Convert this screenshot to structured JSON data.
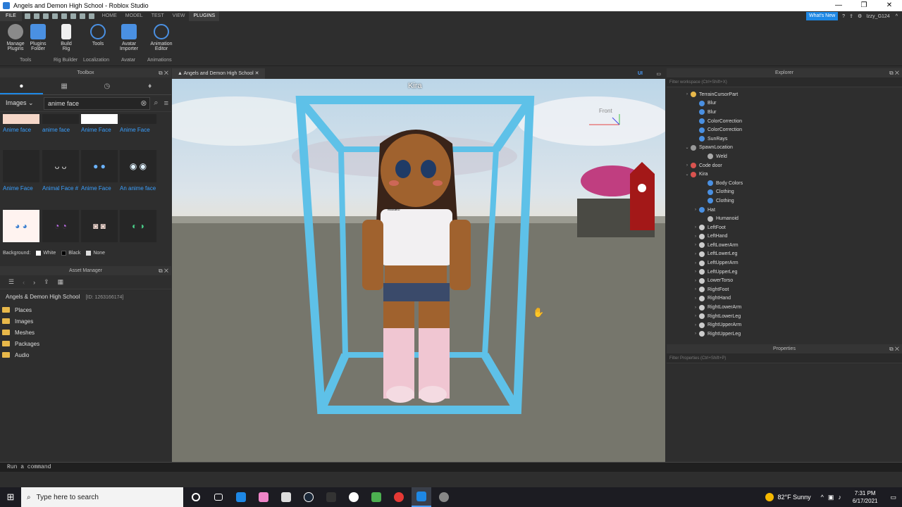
{
  "window": {
    "title": "Angels and Demon High School - Roblox Studio",
    "min": "—",
    "max": "❐",
    "close": "✕"
  },
  "menu": {
    "file": "FILE",
    "tabs": [
      "HOME",
      "MODEL",
      "TEST",
      "VIEW",
      "PLUGINS"
    ],
    "whats_new": "What's New",
    "user": "Izzy_G124"
  },
  "ribbon": {
    "buttons": [
      {
        "l1": "Manage",
        "l2": "Plugins"
      },
      {
        "l1": "Plugins",
        "l2": "Folder"
      },
      {
        "l1": "Build",
        "l2": "Rig"
      },
      {
        "l1": "Tools",
        "l2": ""
      },
      {
        "l1": "Avatar",
        "l2": "Importer"
      },
      {
        "l1": "Animation",
        "l2": "Editor"
      }
    ],
    "groups": [
      "Tools",
      "Rig Builder",
      "Localization",
      "Avatar",
      "Animations"
    ]
  },
  "toolbox": {
    "title": "Toolbox",
    "category": "Images",
    "search_value": "anime face",
    "items": [
      "Anime face",
      "anime face",
      "Anime Face",
      "Anime Face",
      "Anime Face",
      "Animal Face #",
      "Anime Face",
      "An anime face",
      "",
      "",
      "",
      ""
    ],
    "background_label": "Background:",
    "bg_options": [
      "White",
      "Black",
      "None"
    ]
  },
  "asset_manager": {
    "title": "Asset Manager",
    "game": "Angels & Demon High School",
    "id": "[ID: 1263166174]",
    "folders": [
      "Places",
      "Images",
      "Meshes",
      "Packages",
      "Audio"
    ]
  },
  "viewport": {
    "tab": "Angels and Demon High School",
    "ui_toggle": "UI",
    "name_label": "Kira",
    "cube_label": "Front",
    "shirt_tag": "Masako"
  },
  "explorer": {
    "title": "Explorer",
    "filter_placeholder": "Filter workspace (Ctrl+Shift+X)",
    "items": [
      {
        "label": "TerrainCursorPart",
        "depth": 1,
        "arrow": "›",
        "color": "#e8b84a"
      },
      {
        "label": "Blur",
        "depth": 2,
        "arrow": "",
        "color": "#4a90e2"
      },
      {
        "label": "Blur",
        "depth": 2,
        "arrow": "",
        "color": "#4a90e2"
      },
      {
        "label": "ColorCorrection",
        "depth": 2,
        "arrow": "",
        "color": "#4a90e2"
      },
      {
        "label": "ColorCorrection",
        "depth": 2,
        "arrow": "",
        "color": "#4a90e2"
      },
      {
        "label": "SunRays",
        "depth": 2,
        "arrow": "",
        "color": "#4a90e2"
      },
      {
        "label": "SpawnLocation",
        "depth": 1,
        "arrow": "⌄",
        "color": "#999999"
      },
      {
        "label": "Weld",
        "depth": 3,
        "arrow": "",
        "color": "#aaaaaa"
      },
      {
        "label": "Code door",
        "depth": 1,
        "arrow": "›",
        "color": "#d9534f"
      },
      {
        "label": "Kira",
        "depth": 1,
        "arrow": "⌄",
        "color": "#d9534f"
      },
      {
        "label": "Body Colors",
        "depth": 3,
        "arrow": "",
        "color": "#4a90e2"
      },
      {
        "label": "Clothing",
        "depth": 3,
        "arrow": "",
        "color": "#4a90e2"
      },
      {
        "label": "Clothing",
        "depth": 3,
        "arrow": "",
        "color": "#4a90e2"
      },
      {
        "label": "Hat",
        "depth": 2,
        "arrow": "›",
        "color": "#4a90e2"
      },
      {
        "label": "Humanoid",
        "depth": 3,
        "arrow": "",
        "color": "#bbbbbb"
      },
      {
        "label": "LeftFoot",
        "depth": 2,
        "arrow": "›",
        "color": "#cccccc"
      },
      {
        "label": "LeftHand",
        "depth": 2,
        "arrow": "›",
        "color": "#cccccc"
      },
      {
        "label": "LeftLowerArm",
        "depth": 2,
        "arrow": "›",
        "color": "#cccccc"
      },
      {
        "label": "LeftLowerLeg",
        "depth": 2,
        "arrow": "›",
        "color": "#cccccc"
      },
      {
        "label": "LeftUpperArm",
        "depth": 2,
        "arrow": "›",
        "color": "#cccccc"
      },
      {
        "label": "LeftUpperLeg",
        "depth": 2,
        "arrow": "›",
        "color": "#cccccc"
      },
      {
        "label": "LowerTorso",
        "depth": 2,
        "arrow": "›",
        "color": "#cccccc"
      },
      {
        "label": "RightFoot",
        "depth": 2,
        "arrow": "›",
        "color": "#cccccc"
      },
      {
        "label": "RightHand",
        "depth": 2,
        "arrow": "›",
        "color": "#cccccc"
      },
      {
        "label": "RightLowerArm",
        "depth": 2,
        "arrow": "›",
        "color": "#cccccc"
      },
      {
        "label": "RightLowerLeg",
        "depth": 2,
        "arrow": "›",
        "color": "#cccccc"
      },
      {
        "label": "RightUpperArm",
        "depth": 2,
        "arrow": "›",
        "color": "#cccccc"
      },
      {
        "label": "RightUpperLeg",
        "depth": 2,
        "arrow": "›",
        "color": "#cccccc"
      }
    ]
  },
  "properties": {
    "title": "Properties",
    "filter_placeholder": "Filter Properties (Ctrl+Shift+P)"
  },
  "command_bar": {
    "placeholder": "Run a command"
  },
  "taskbar": {
    "search_placeholder": "Type here to search",
    "weather": "82°F  Sunny",
    "time": "7:31 PM",
    "date": "6/17/2021"
  }
}
